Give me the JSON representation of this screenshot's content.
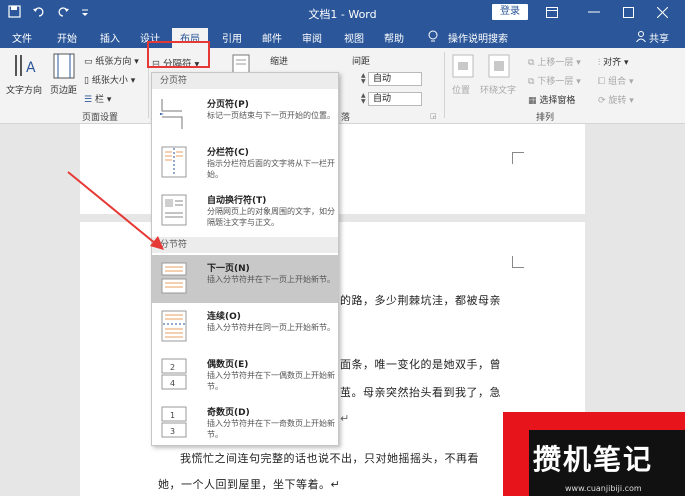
{
  "titlebar": {
    "title": "文档1 - Word",
    "login": "登录"
  },
  "tabs": [
    "文件",
    "开始",
    "插入",
    "设计",
    "布局",
    "引用",
    "邮件",
    "审阅",
    "视图",
    "帮助"
  ],
  "active_tab": "布局",
  "tell_me": "操作说明搜索",
  "share": "共享",
  "ribbon": {
    "text_direction": "文字方向",
    "margins": "页边距",
    "orientation": "纸张方向",
    "size": "纸张大小",
    "columns": "栏",
    "page_setup_group": "页面设置",
    "breaks_button": "分隔符",
    "indent_label": "缩进",
    "spacing_label": "间距",
    "spacing_before": "自动",
    "spacing_after": "自动",
    "paragraph_group_tail": "落",
    "position": "位置",
    "wrap_text": "环绕文字",
    "bring_forward": "上移一层",
    "send_backward": "下移一层",
    "selection_pane": "选择窗格",
    "align": "对齐",
    "group": "组合",
    "rotate": "旋转",
    "arrange_group": "排列"
  },
  "dropdown": {
    "page_breaks_header": "分页符",
    "section_breaks_header": "分节符",
    "items": [
      {
        "title": "分页符(P)",
        "desc": "标记一页结束与下一页开始的位置。"
      },
      {
        "title": "分栏符(C)",
        "desc": "指示分栏符后面的文字将从下一栏开始。"
      },
      {
        "title": "自动换行符(T)",
        "desc": "分隔网页上的对象周围的文字，如分隔题注文字与正文。"
      },
      {
        "title": "下一页(N)",
        "desc": "插入分节符并在下一页上开始新节。"
      },
      {
        "title": "连续(O)",
        "desc": "插入分节符并在同一页上开始新节。"
      },
      {
        "title": "偶数页(E)",
        "desc": "插入分节符并在下一偶数页上开始新节。"
      },
      {
        "title": "奇数页(D)",
        "desc": "插入分节符并在下一奇数页上开始新节。"
      }
    ]
  },
  "document": {
    "line1": "的路，多少荆棘坑洼，都被母亲",
    "line2": "面条，唯一变化的是她双手，曾",
    "line3": "茧。母亲突然抬头看到我了，急",
    "line4": "我慌忙之间连句完整的话也说不出，只对她摇摇头，不再看",
    "line5": "她，一个人回到屋里，坐下等着。↵",
    "mark": "↵"
  },
  "watermark": {
    "text": "攒机笔记",
    "url": "www.cuanjibiji.com"
  },
  "colors": {
    "brand": "#2b579a",
    "highlight_red": "#e53935"
  }
}
